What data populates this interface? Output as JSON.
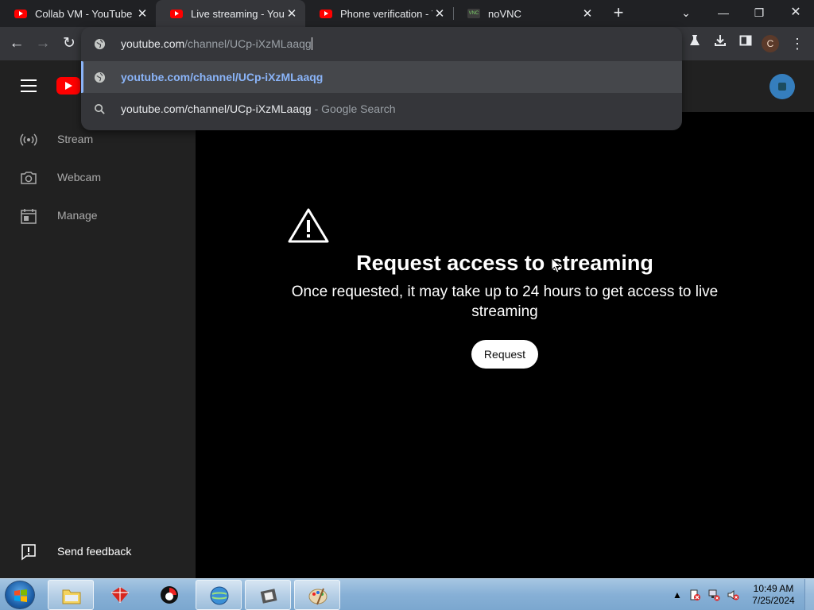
{
  "browser": {
    "tabs": [
      {
        "title": "Collab VM - YouTube",
        "favicon": "youtube-icon",
        "active": false
      },
      {
        "title": "Live streaming - YouTube",
        "favicon": "youtube-icon",
        "active": true
      },
      {
        "title": "Phone verification - YouTube",
        "favicon": "youtube-icon",
        "active": false
      },
      {
        "title": "noVNC",
        "favicon": "vnc-icon",
        "active": false
      }
    ],
    "vnc_favicon_text": "VNC",
    "new_tab_label": "+",
    "omnibox": {
      "host": "youtube.com",
      "path": "/channel/UCp-iXzMLaaqg"
    },
    "suggestions": [
      {
        "text": "youtube.com/channel/UCp-iXzMLaaqg",
        "suffix": "",
        "icon": "globe-icon",
        "selected": true
      },
      {
        "text": "youtube.com/channel/UCp-iXzMLaaqg",
        "suffix": " - Google Search",
        "icon": "search-icon",
        "selected": false
      }
    ],
    "profile_initial": "C"
  },
  "youtube": {
    "sidebar": {
      "items": [
        {
          "label": "Stream",
          "icon": "stream-icon"
        },
        {
          "label": "Webcam",
          "icon": "webcam-icon"
        },
        {
          "label": "Manage",
          "icon": "calendar-icon"
        }
      ],
      "feedback_label": "Send feedback"
    },
    "main": {
      "title": "Request access to streaming",
      "subtitle": "Once requested, it may take up to 24 hours to get access to live streaming",
      "button_label": "Request"
    }
  },
  "taskbar": {
    "time": "10:49 AM",
    "date": "7/25/2024",
    "apps": [
      "explorer",
      "app-red",
      "app-red-2",
      "ie",
      "media",
      "paint"
    ]
  },
  "colors": {
    "accent_link": "#8ab4f8",
    "youtube_red": "#ff0000",
    "page_bg": "#000000",
    "sidebar_bg": "#212121"
  }
}
